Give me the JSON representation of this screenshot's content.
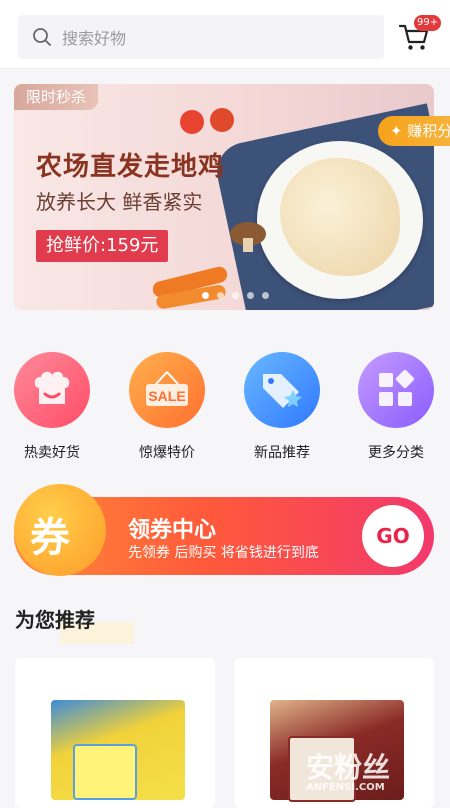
{
  "search": {
    "placeholder": "搜索好物",
    "icon": "search-icon"
  },
  "cart": {
    "icon": "cart-icon",
    "badge": "99+"
  },
  "banner": {
    "tag": "限时秒杀",
    "title": "农场直发走地鸡",
    "subtitle": "放养长大 鲜香紧实",
    "price": "抢鲜价:159元",
    "earn": "赚积分",
    "slides": 5,
    "active_slide": 1
  },
  "categories": [
    {
      "label": "热卖好货",
      "icon": "chef-hat-icon",
      "color": "#ff5d73"
    },
    {
      "label": "惊爆特价",
      "icon": "sale-sign-icon",
      "color": "#ff8a3d"
    },
    {
      "label": "新品推荐",
      "icon": "new-tag-icon",
      "color": "#3d8bff"
    },
    {
      "label": "更多分类",
      "icon": "grid-icon",
      "color": "#9b6bff"
    }
  ],
  "coupon": {
    "icon_char": "券",
    "title": "领券中心",
    "subtitle": "先领券 后购买 将省钱进行到底",
    "button": "GO"
  },
  "recommend": {
    "title": "为您推荐"
  },
  "products": [
    {
      "image": "product-milk-box-yellow"
    },
    {
      "image": "product-chocolate-box-red"
    }
  ],
  "watermark": {
    "text": "安粉丝",
    "sub": "ANFENSI.COM"
  },
  "colors": {
    "accent": "#e03c4e",
    "coupon_start": "#ff8a3a",
    "coupon_end": "#f2386c"
  }
}
